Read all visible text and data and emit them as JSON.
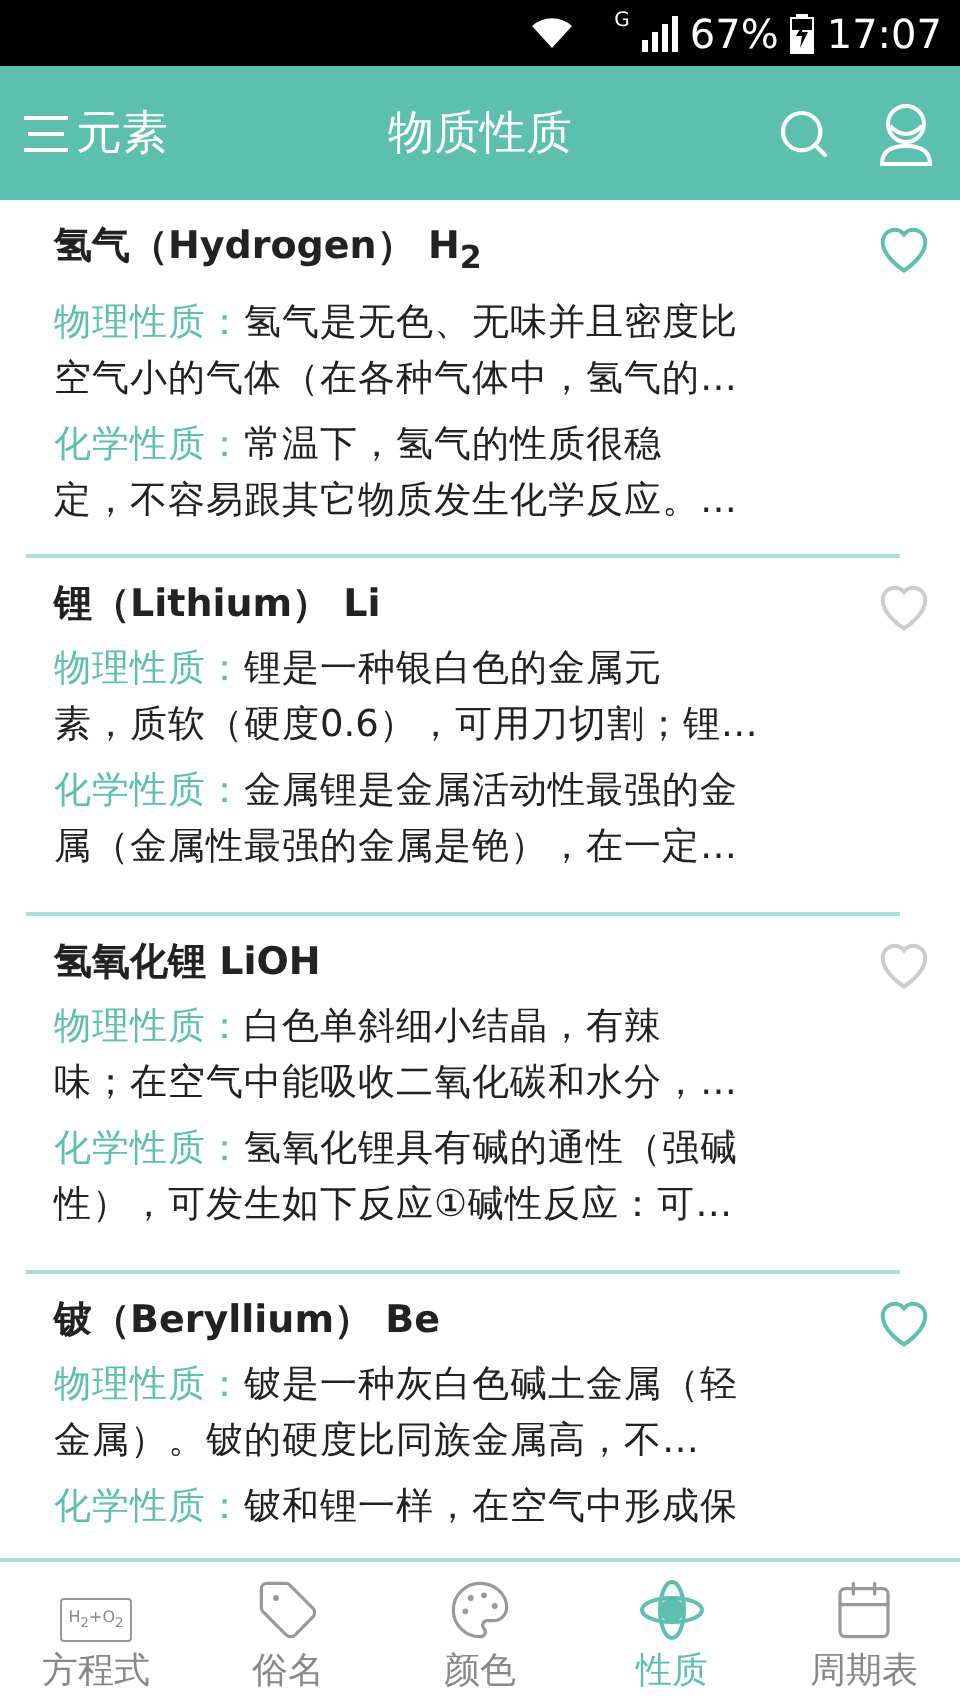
{
  "status_bar": {
    "network": "G",
    "battery": "67%",
    "time": "17:07"
  },
  "header": {
    "menu_label": "元素",
    "title": "物质性质"
  },
  "items": [
    {
      "title": "氢气（Hydrogen） H$_{2}$",
      "favorite": true,
      "properties": [
        {
          "label": "物理性质：",
          "lines": [
            "氢气是无色、无味并且密度比",
            "空气小的气体（在各种气体中，氢气的…"
          ]
        },
        {
          "label": "化学性质：",
          "lines": [
            "常温下，氢气的性质很稳",
            "定，不容易跟其它物质发生化学反应。…"
          ]
        }
      ]
    },
    {
      "title": "锂（Lithium） Li",
      "favorite": false,
      "properties": [
        {
          "label": "物理性质：",
          "lines": [
            "锂是一种银白色的金属元",
            "素，质软（硬度0.6），可用刀切割；锂…"
          ]
        },
        {
          "label": "化学性质：",
          "lines": [
            "金属锂是金属活动性最强的金",
            "属（金属性最强的金属是铯），在一定…"
          ]
        }
      ]
    },
    {
      "title": "氢氧化锂 LiOH",
      "favorite": false,
      "properties": [
        {
          "label": "物理性质：",
          "lines": [
            "白色单斜细小结晶，有辣",
            "味；在空气中能吸收二氧化碳和水分，…"
          ]
        },
        {
          "label": "化学性质：",
          "lines": [
            "氢氧化锂具有碱的通性（强碱",
            "性），可发生如下反应①碱性反应：可…"
          ]
        }
      ]
    },
    {
      "title": "铍（Beryllium） Be",
      "favorite": true,
      "properties": [
        {
          "label": "物理性质：",
          "lines": [
            "铍是一种灰白色碱土金属（轻",
            "金属）。铍的硬度比同族金属高，不…"
          ]
        },
        {
          "label": "化学性质：",
          "lines": [
            "铍和锂一样，在空气中形成保"
          ]
        }
      ]
    }
  ],
  "tabs": [
    {
      "kind": "equation",
      "icon_text": "H$_{2}$+O$_{2}$",
      "label": "方程式",
      "selected": false
    },
    {
      "kind": "tag",
      "label": "俗名",
      "selected": false
    },
    {
      "kind": "palette",
      "label": "颜色",
      "selected": false
    },
    {
      "kind": "atom",
      "label": "性质",
      "selected": true
    },
    {
      "kind": "calendar",
      "label": "周期表",
      "selected": false
    }
  ]
}
